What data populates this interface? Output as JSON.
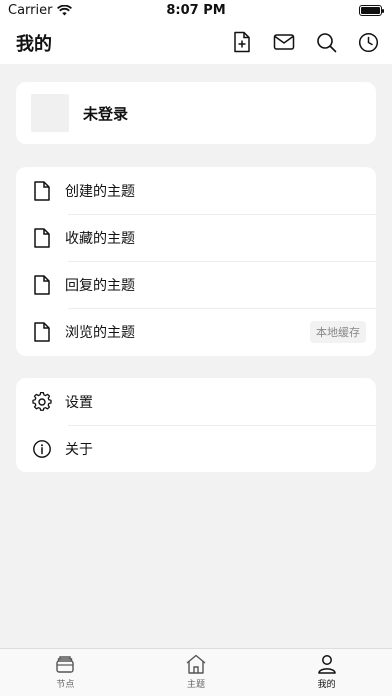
{
  "status": {
    "carrier": "Carrier",
    "time": "8:07 PM"
  },
  "nav": {
    "title": "我的",
    "actions": [
      "new-topic",
      "notifications",
      "search",
      "history"
    ]
  },
  "profile": {
    "name": "未登录"
  },
  "topics": [
    {
      "label": "创建的主题",
      "icon": "file-icon"
    },
    {
      "label": "收藏的主题",
      "icon": "file-icon"
    },
    {
      "label": "回复的主题",
      "icon": "file-icon"
    },
    {
      "label": "浏览的主题",
      "icon": "file-icon",
      "badge": "本地缓存"
    }
  ],
  "settings": [
    {
      "label": "设置",
      "icon": "gear-icon"
    },
    {
      "label": "关于",
      "icon": "info-icon"
    }
  ],
  "tabs": [
    {
      "label": "节点",
      "icon": "layers-icon"
    },
    {
      "label": "主题",
      "icon": "home-icon"
    },
    {
      "label": "我的",
      "icon": "person-icon",
      "active": true
    }
  ]
}
